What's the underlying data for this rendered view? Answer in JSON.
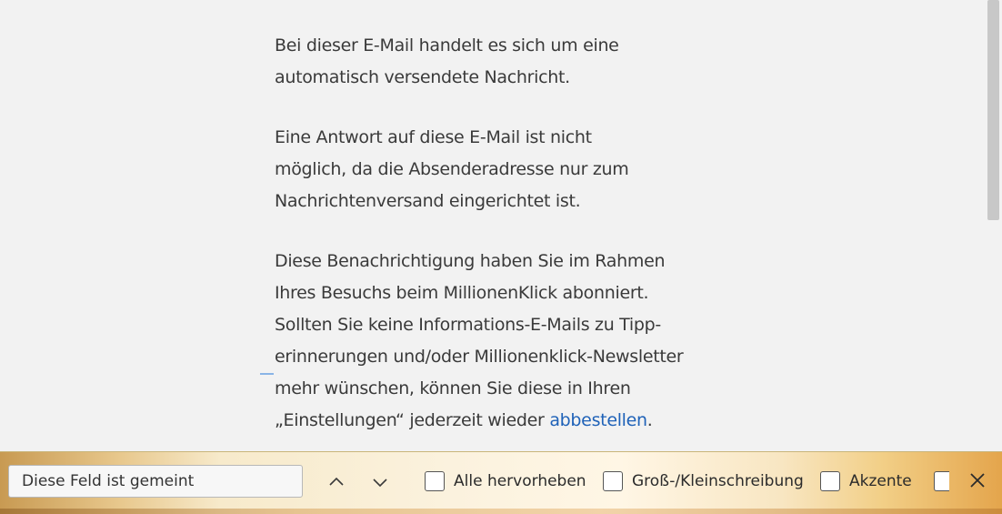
{
  "message": {
    "paragraphs": [
      {
        "lines": [
          "Bei dieser E-Mail handelt es sich um eine",
          "automatisch versendete Nachricht."
        ]
      },
      {
        "lines": [
          "Eine Antwort auf diese E-Mail ist nicht",
          "möglich, da die Absenderadresse nur zum",
          "Nachrichtenversand eingerichtet ist."
        ]
      },
      {
        "lines": [
          "Diese Benachrichtigung haben Sie im Rahmen",
          "Ihres Besuchs beim MillionenKlick abonniert.",
          "Sollten Sie keine Informations-E-Mails zu Tipp-",
          "erinnerungen und/oder Millionenklick-Newsletter",
          "mehr wünschen, können Sie diese in Ihren"
        ],
        "last_line_prefix": "„Einstellungen“ jederzeit wieder ",
        "link_text": "abbestellen",
        "last_line_suffix": "."
      }
    ],
    "link_color": "#1f62b8"
  },
  "findbar": {
    "search_value": "Diese Feld ist gemeint",
    "prev_icon": "chevron-up-icon",
    "next_icon": "chevron-down-icon",
    "options": [
      {
        "label": "Alle hervorheben",
        "checked": false
      },
      {
        "label": "Groß-/Kleinschreibung",
        "checked": false
      },
      {
        "label": "Akzente",
        "checked": false
      },
      {
        "label": "",
        "checked": false
      }
    ],
    "close_icon": "close-icon"
  }
}
